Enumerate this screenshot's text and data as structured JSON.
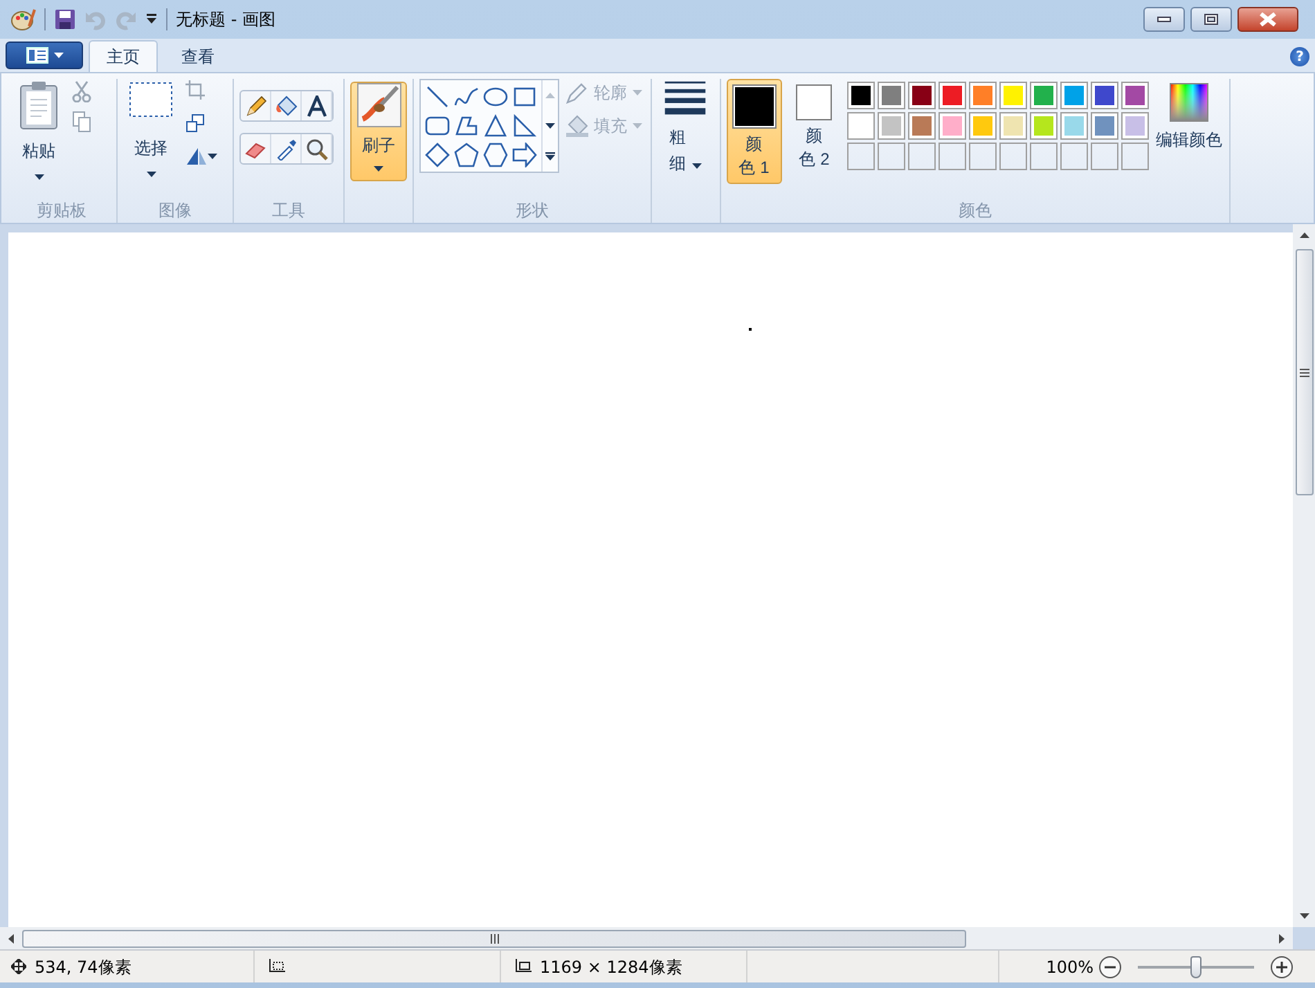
{
  "window": {
    "title": "无标题 - 画图"
  },
  "tabs": [
    {
      "label": "主页",
      "selected": true
    },
    {
      "label": "查看",
      "selected": false
    }
  ],
  "help": "?",
  "clipboard": {
    "paste": "粘贴",
    "label": "剪贴板"
  },
  "image": {
    "select": "选择",
    "label": "图像"
  },
  "tools": {
    "label": "工具"
  },
  "brushes": {
    "label": "刷子",
    "selected": true
  },
  "shapes": {
    "label": "形状",
    "outline": {
      "label": "轮廓",
      "disabled": true
    },
    "fill": {
      "label": "填充",
      "disabled": true
    }
  },
  "size": {
    "label": "粗细"
  },
  "colors": {
    "label": "颜色",
    "edit": "编辑颜色",
    "slots": [
      {
        "label": "颜色 1",
        "color": "#000000",
        "selected": true
      },
      {
        "label": "颜色 2",
        "color": "#ffffff",
        "selected": false
      }
    ],
    "palette": [
      {
        "kind": "preset",
        "color": "#000000"
      },
      {
        "kind": "preset",
        "color": "#7f7f7f"
      },
      {
        "kind": "preset",
        "color": "#880015"
      },
      {
        "kind": "preset",
        "color": "#ed1c24"
      },
      {
        "kind": "preset",
        "color": "#ff7f27"
      },
      {
        "kind": "preset",
        "color": "#fff200"
      },
      {
        "kind": "preset",
        "color": "#22b14c"
      },
      {
        "kind": "preset",
        "color": "#00a2e8"
      },
      {
        "kind": "preset",
        "color": "#3f48cc"
      },
      {
        "kind": "preset",
        "color": "#a349a4"
      },
      {
        "kind": "preset",
        "color": "#ffffff"
      },
      {
        "kind": "preset",
        "color": "#c3c3c3"
      },
      {
        "kind": "preset",
        "color": "#b97a57"
      },
      {
        "kind": "preset",
        "color": "#ffaec9"
      },
      {
        "kind": "preset",
        "color": "#ffc90e"
      },
      {
        "kind": "preset",
        "color": "#efe4b0"
      },
      {
        "kind": "preset",
        "color": "#b5e61d"
      },
      {
        "kind": "preset",
        "color": "#99d9ea"
      },
      {
        "kind": "preset",
        "color": "#7092be"
      },
      {
        "kind": "preset",
        "color": "#c8bfe7"
      },
      {
        "kind": "empty"
      },
      {
        "kind": "empty"
      },
      {
        "kind": "empty"
      },
      {
        "kind": "empty"
      },
      {
        "kind": "empty"
      },
      {
        "kind": "empty"
      },
      {
        "kind": "empty"
      },
      {
        "kind": "empty"
      },
      {
        "kind": "empty"
      },
      {
        "kind": "empty"
      }
    ]
  },
  "status_bar": {
    "position": "534, 74像素",
    "image_size": "1169 × 1284像素",
    "zoom": "100%",
    "zoom_slider": {
      "level": 0.5
    }
  }
}
